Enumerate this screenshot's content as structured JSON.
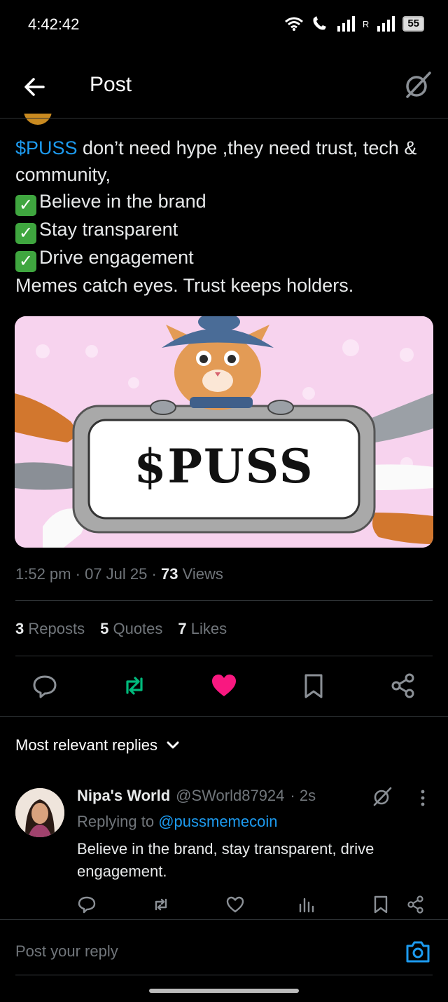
{
  "status_bar": {
    "time": "4:42:42",
    "roaming": "R",
    "battery": "55"
  },
  "header": {
    "title": "Post",
    "back_icon": "arrow-left-icon",
    "grok_icon": "grok-icon"
  },
  "post": {
    "ticker": "$PUSS",
    "line1_rest": " don’t need hype ,they need trust, tech & community,",
    "check_glyph": "✓",
    "bullets": [
      "Believe in the brand",
      "Stay transparent",
      "Drive engagement"
    ],
    "closing": "Memes catch eyes. Trust keeps holders.",
    "image_text": "$PUSS",
    "time": "1:52 pm",
    "date": "07 Jul 25",
    "views_count": "73",
    "views_label": "Views",
    "sep": "·",
    "reposts_count": "3",
    "reposts_label": "Reposts",
    "quotes_count": "5",
    "quotes_label": "Quotes",
    "likes_count": "7",
    "likes_label": "Likes"
  },
  "colors": {
    "accent": "#1d9bf0",
    "repost_green": "#00ba7c",
    "like_pink": "#f91880",
    "muted": "#71767b"
  },
  "replies": {
    "sort_label": "Most relevant replies",
    "items": [
      {
        "name": "Nipa's World",
        "handle": "@SWorld87924",
        "age": "· 2s",
        "replying_prefix": "Replying to ",
        "replying_to": "@pussmemecoin",
        "text": "Believe in the brand, stay transparent, drive engagement."
      }
    ]
  },
  "composer": {
    "placeholder": "Post your reply"
  }
}
